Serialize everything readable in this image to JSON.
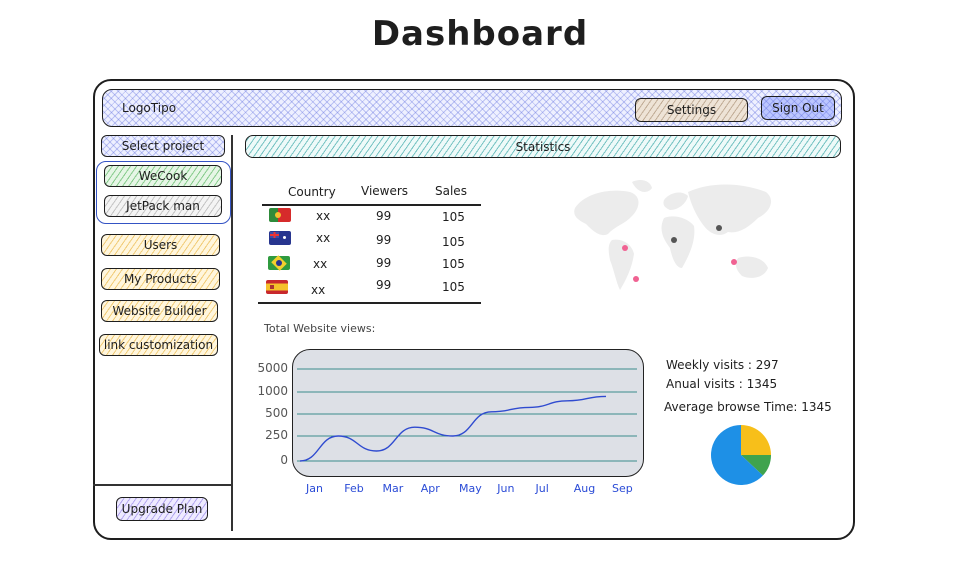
{
  "page_title": "Dashboard",
  "header": {
    "logo_text": "LogoTipo",
    "settings_label": "Settings",
    "signout_label": "Sign Out"
  },
  "sidebar": {
    "select_project_label": "Select project",
    "projects": [
      {
        "label": "WeCook"
      },
      {
        "label": "JetPack man"
      }
    ],
    "items": [
      {
        "label": "Users"
      },
      {
        "label": "My Products"
      },
      {
        "label": "Website Builder"
      },
      {
        "label": "link customization"
      }
    ],
    "upgrade_label": "Upgrade Plan"
  },
  "statistics_title": "Statistics",
  "table": {
    "headers": [
      "Country",
      "Viewers",
      "Sales"
    ],
    "rows": [
      {
        "flag_icon": "portugal-flag-icon",
        "country": "xx",
        "viewers": "99",
        "sales": "105"
      },
      {
        "flag_icon": "australia-flag-icon",
        "country": "xx",
        "viewers": "99",
        "sales": "105"
      },
      {
        "flag_icon": "brazil-flag-icon",
        "country": "xx",
        "viewers": "99",
        "sales": "105"
      },
      {
        "flag_icon": "spain-flag-icon",
        "country": "xx",
        "viewers": "99",
        "sales": "105"
      }
    ]
  },
  "chart_title": "Total Website views:",
  "stats": {
    "weekly": "Weekly visits : 297",
    "annual": "Anual visits : 1345",
    "browse_time": "Average browse Time: 1345"
  },
  "colors": {
    "line": "#2f4bd0",
    "grid": "#3a8c8c",
    "pie_yellow": "#f7bf1a",
    "pie_green": "#3fa34d",
    "pie_blue": "#1e90e6"
  },
  "chart_data": {
    "type": "line",
    "categories": [
      "Jan",
      "Feb",
      "Mar",
      "Apr",
      "May",
      "Jun",
      "Jul",
      "Aug",
      "Sep"
    ],
    "y_tick_labels": [
      "0",
      "250",
      "500",
      "1000",
      "5000"
    ],
    "series": [
      {
        "values": [
          0,
          250,
          100,
          350,
          250,
          550,
          650,
          800,
          900
        ]
      }
    ],
    "title": "Total Website views:",
    "grid": true
  },
  "pie_data": {
    "type": "pie",
    "values": [
      25,
      12,
      63
    ]
  }
}
